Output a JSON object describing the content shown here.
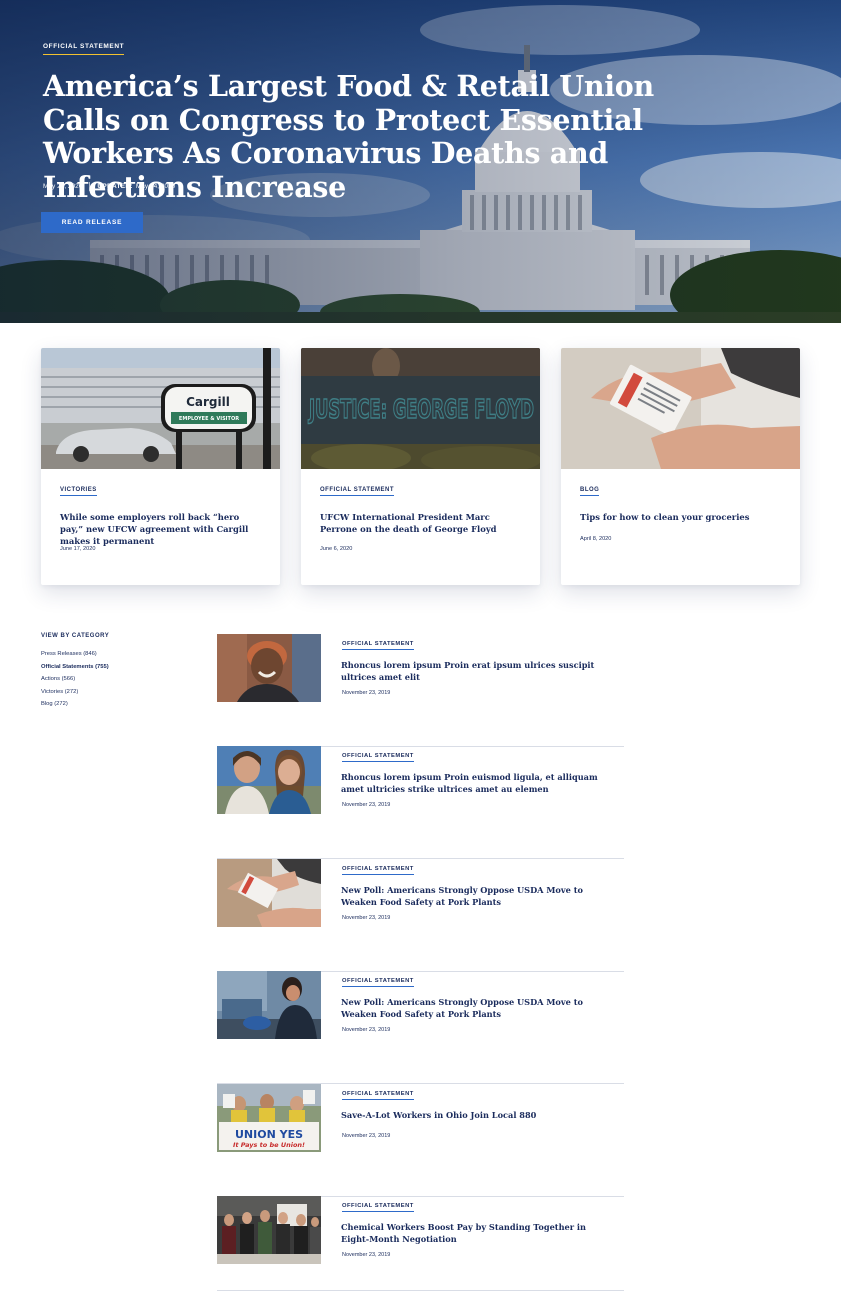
{
  "hero": {
    "eyebrow": "OFFICIAL STATEMENT",
    "title": "America’s Largest Food & Retail Union Calls on Congress to Protect Essential Workers As Coronavirus Deaths and Infections Increase",
    "date": "May 22, 2020",
    "updated_label": "UPDATED:",
    "updated_date": "May 24, 2020",
    "button_label": "READ RELEASE"
  },
  "featured": [
    {
      "tag": "VICTORIES",
      "title": "While some employers roll back “hero pay,” new UFCW agreement with Cargill makes it permanent",
      "date": "June 17, 2020",
      "image": "cargill-sign-photo"
    },
    {
      "tag": "OFFICIAL STATEMENT",
      "title": "UFCW International President Marc Perrone on the death of George Floyd",
      "date": "June 6, 2020",
      "image": "justice-george-floyd-banner-photo",
      "image_text": "JUSTICE: GEORGE FLOYD"
    },
    {
      "tag": "BLOG",
      "title": "Tips for how to clean your groceries",
      "date": "April 8, 2020",
      "image": "hand-holding-grocery-box-photo"
    }
  ],
  "sidebar": {
    "heading": "VIEW BY CATEGORY",
    "categories": [
      {
        "label": "Press Releases (846)",
        "active": false
      },
      {
        "label": "Official Statements (755)",
        "active": true
      },
      {
        "label": "Actions (566)",
        "active": false
      },
      {
        "label": "Victories (272)",
        "active": false
      },
      {
        "label": "Blog (272)",
        "active": false
      }
    ]
  },
  "articles": [
    {
      "tag": "OFFICIAL STATEMENT",
      "title": "Rhoncus lorem ipsum Proin erat ipsum ulrices suscipit ultrices amet elit",
      "date": "November 23, 2019",
      "image": "smiling-worker-photo"
    },
    {
      "tag": "OFFICIAL STATEMENT",
      "title": "Rhoncus lorem ipsum Proin euismod ligula, et alliquam amet ultricies strike ultrices amet au elemen",
      "date": "November 23, 2019",
      "image": "two-women-selfie-photo"
    },
    {
      "tag": "OFFICIAL STATEMENT",
      "title": "New Poll: Americans Strongly Oppose USDA Move to Weaken Food Safety at Pork Plants",
      "date": "November 23, 2019",
      "image": "hand-holding-grocery-box-photo"
    },
    {
      "tag": "OFFICIAL STATEMENT",
      "title": "New Poll: Americans Strongly Oppose USDA Move to Weaken Food Safety at Pork Plants",
      "date": "November 23, 2019",
      "image": "cashier-checkout-photo"
    },
    {
      "tag": "OFFICIAL STATEMENT",
      "title": "Save-A-Lot Workers in Ohio Join Local 880",
      "date": "November 23, 2019",
      "image": "union-yes-banner-photo",
      "image_text": "UNION YES",
      "image_subtext": "It Pays to be Union!"
    },
    {
      "tag": "OFFICIAL STATEMENT",
      "title": "Chemical Workers Boost Pay by Standing Together in Eight-Month Negotiation",
      "date": "November 23, 2019",
      "image": "workers-group-photo"
    }
  ],
  "colors": {
    "navy": "#1a2b5c",
    "accent_blue": "#2e6ac9",
    "gold": "#f2c230"
  }
}
